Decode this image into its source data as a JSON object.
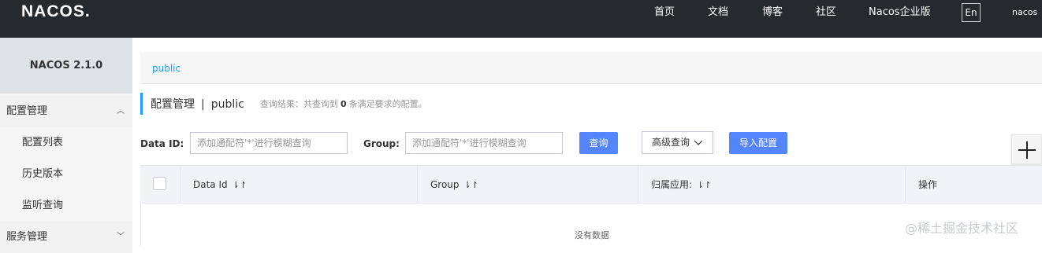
{
  "app": {
    "logo_text_a": "NA",
    "logo_text_b": "C",
    "logo_text_c": "OS",
    "logo_dot": "."
  },
  "nav": {
    "items": [
      "首页",
      "文档",
      "博客",
      "社区",
      "Nacos企业版"
    ],
    "lang_button": "En",
    "user": "nacos"
  },
  "sidebar": {
    "version": "NACOS 2.1.0",
    "group_config": "配置管理",
    "items": [
      "配置列表",
      "历史版本",
      "监听查询"
    ],
    "group_service": "服务管理",
    "chevron_up": "︿",
    "chevron_down": "﹀"
  },
  "breadcrumb": {
    "namespace": "public"
  },
  "page": {
    "title": "配置管理",
    "separator": "|",
    "namespace": "public",
    "summary_prefix": "查询结果：共查询到",
    "summary_count": "0",
    "summary_suffix": "条满足要求的配置。"
  },
  "filters": {
    "data_id_label": "Data ID:",
    "data_id_placeholder": "添加通配符'*'进行模糊查询",
    "group_label": "Group:",
    "group_placeholder": "添加通配符'*'进行模糊查询",
    "query_button": "查询",
    "advanced_button": "高级查询",
    "import_button": "导入配置"
  },
  "table": {
    "columns": [
      "Data Id",
      "Group",
      "归属应用:",
      "操作"
    ],
    "sort_icon": "⇂↾",
    "empty_text": "没有数据"
  },
  "watermark": "@稀土掘金技术社区",
  "colors": {
    "topbar": "#252a2f",
    "accent": "#209bfa",
    "primary_button": "#5584ff"
  }
}
